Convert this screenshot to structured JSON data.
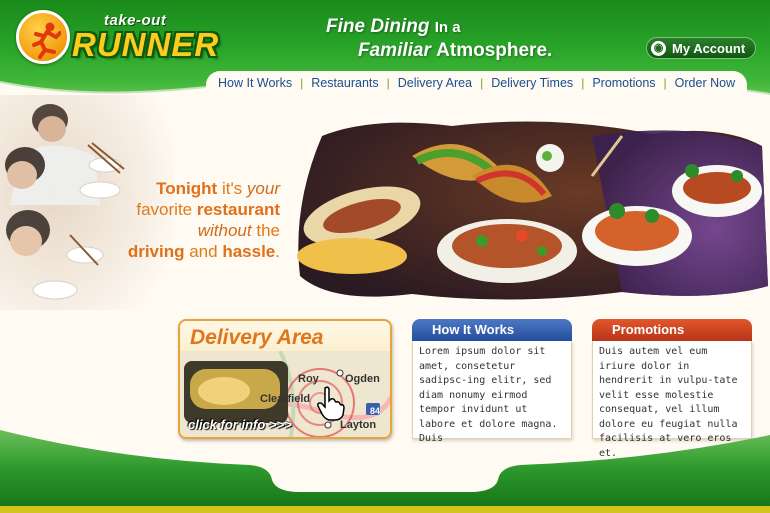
{
  "brand": {
    "logo_top": "take-out",
    "logo_main": "RUNNER"
  },
  "tagline": {
    "line1_a": "Fine Dining",
    "line1_b": "In a",
    "line2_a": "Familiar",
    "line2_b": "Atmosphere."
  },
  "account": {
    "label": "My Account",
    "icon": "globe-icon"
  },
  "nav": {
    "items": [
      {
        "label": "How It Works"
      },
      {
        "label": "Restaurants"
      },
      {
        "label": "Delivery Area"
      },
      {
        "label": "Delivery Times"
      },
      {
        "label": "Promotions"
      },
      {
        "label": "Order Now"
      }
    ]
  },
  "hero": {
    "l1_a": "Tonight",
    "l1_b": "it's",
    "l1_c": "your",
    "l2_a": "favorite",
    "l2_b": "restaurant",
    "l3_a": "without",
    "l3_b": "the",
    "l4_a": "driving",
    "l4_b": "and",
    "l4_c": "hassle",
    "l4_d": "."
  },
  "delivery_card": {
    "title": "Delivery Area",
    "cta": "click for info >>>",
    "map_labels": [
      "Roy",
      "Ogden",
      "Clearfield",
      "Layton",
      "84"
    ]
  },
  "how_it_works": {
    "title": "How It Works",
    "body": "Lorem ipsum dolor sit amet, consetetur sadipsc-ing elitr, sed diam nonumy eirmod tempor invidunt ut labore et dolore magna. Duis"
  },
  "promotions": {
    "title": "Promotions",
    "body": "Duis autem vel eum iriure dolor in hendrerit in vulpu-tate velit esse molestie consequat, vel illum dolore eu feugiat nulla facilisis at vero eros et."
  },
  "colors": {
    "header_green": "#1a8a1a",
    "accent_orange": "#e0761c",
    "nav_link": "#1a4f8f",
    "how_tab": "#244e9c",
    "promo_tab": "#b8341a"
  }
}
